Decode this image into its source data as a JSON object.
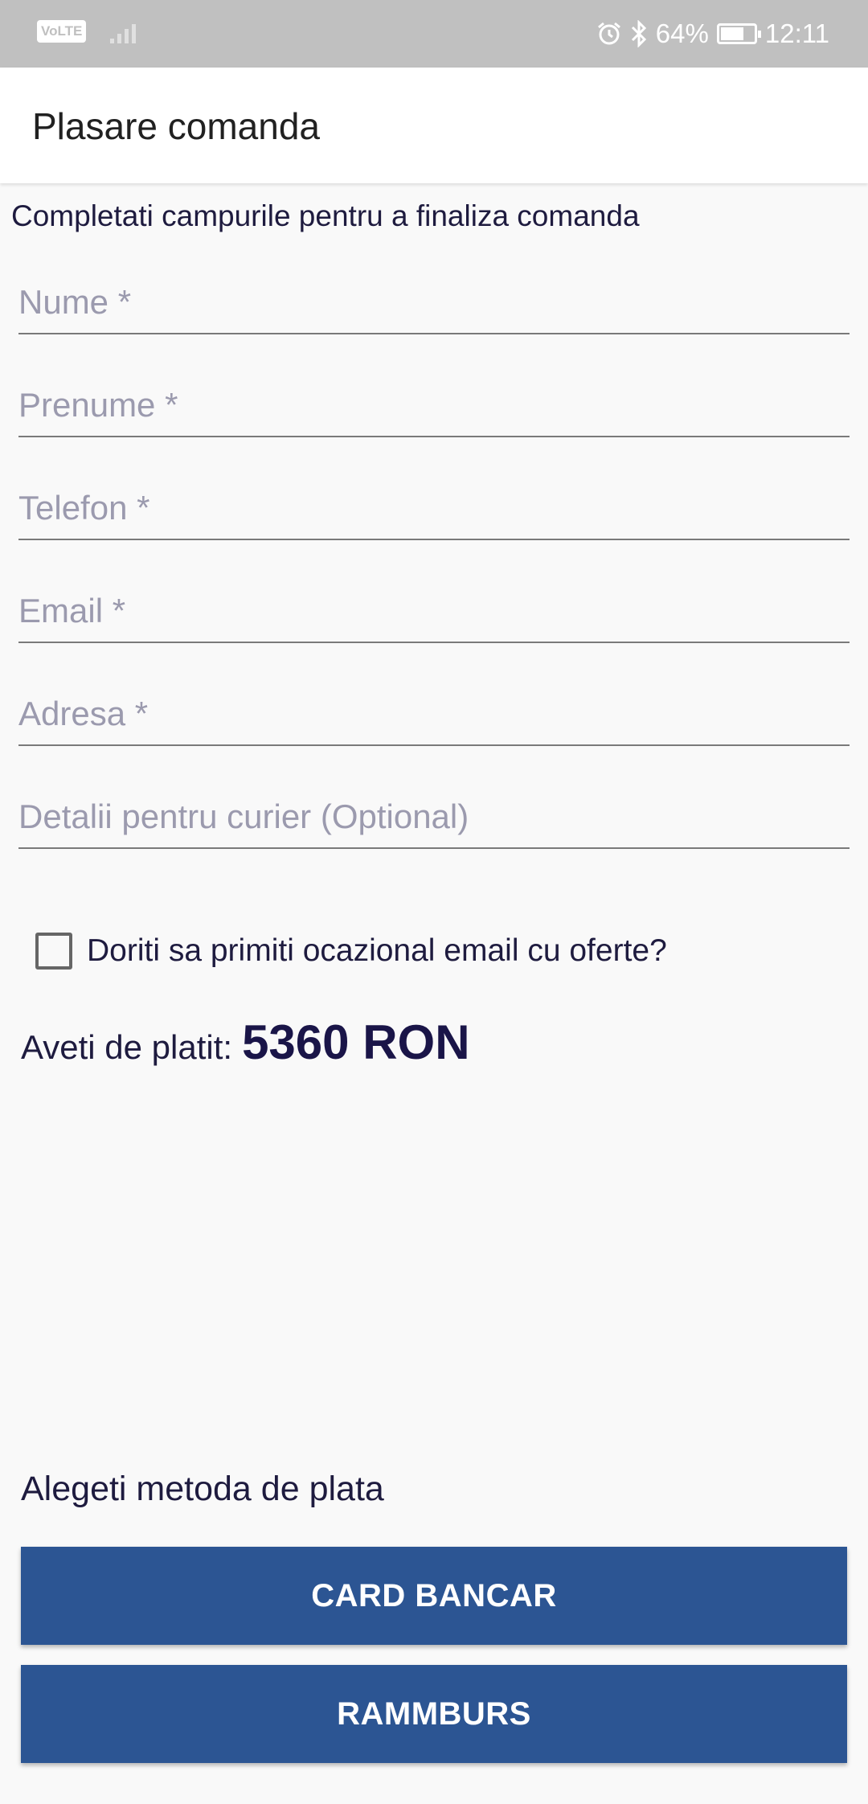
{
  "status_bar": {
    "network_badge": "VoLTE",
    "icons": [
      "alarm-icon",
      "bluetooth-icon"
    ],
    "battery_percent": "64%",
    "battery_level": 0.64,
    "time": "12:11"
  },
  "app_bar": {
    "title": "Plasare comanda"
  },
  "form": {
    "intro": "Completati campurile pentru a finaliza comanda",
    "fields": [
      {
        "placeholder": "Nume *",
        "value": ""
      },
      {
        "placeholder": "Prenume *",
        "value": ""
      },
      {
        "placeholder": "Telefon *",
        "value": ""
      },
      {
        "placeholder": "Email *",
        "value": ""
      },
      {
        "placeholder": "Adresa *",
        "value": ""
      },
      {
        "placeholder": "Detalii pentru curier (Optional)",
        "value": ""
      }
    ],
    "newsletter": {
      "label": "Doriti sa primiti ocazional email cu oferte?",
      "checked": false
    }
  },
  "total": {
    "label": "Aveti de platit:",
    "amount": "5360 RON"
  },
  "payment": {
    "title": "Alegeti metoda de plata",
    "card_label": "CARD BANCAR",
    "cash_label": "RAMMBURS"
  },
  "colors": {
    "accent": "#2c5593",
    "text": "#1e1b3f",
    "placeholder": "#9b9aae",
    "status_bar": "#c0c0c0"
  }
}
